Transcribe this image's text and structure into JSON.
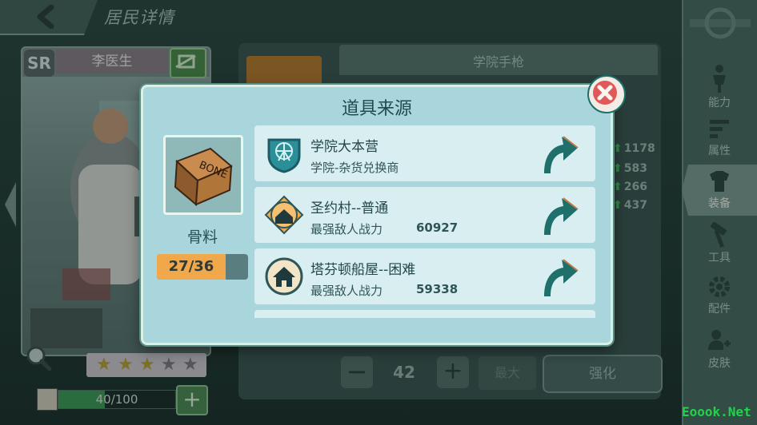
{
  "header": {
    "title": "居民详情"
  },
  "character": {
    "rarity": "SR",
    "name": "李医生",
    "stars_filled": 3,
    "stars_total": 5,
    "hp_text": "40/100",
    "hp_fraction": 0.4,
    "hp_add": "+"
  },
  "equipment": {
    "name": "学院手枪",
    "stats": [
      "1178",
      "583",
      "266",
      "437"
    ],
    "quantity": "42",
    "minus": "−",
    "plus": "+",
    "max_label": "最大",
    "enhance_label": "强化"
  },
  "sidebar": {
    "items": [
      {
        "label": "能力",
        "icon": "figure-icon"
      },
      {
        "label": "属性",
        "icon": "bars-icon"
      },
      {
        "label": "装备",
        "icon": "armor-icon"
      },
      {
        "label": "工具",
        "icon": "hammer-icon"
      },
      {
        "label": "配件",
        "icon": "gear-icon"
      },
      {
        "label": "皮肤",
        "icon": "person-add-icon"
      }
    ],
    "active": "装备"
  },
  "modal": {
    "title": "道具来源",
    "item": {
      "name": "骨料",
      "box_text": "BONE",
      "count_text": "27/36",
      "fraction": 0.75
    },
    "sources": [
      {
        "name": "学院大本营",
        "sub": "学院-杂货兑换商",
        "power": "",
        "icon": "institute-shield-icon"
      },
      {
        "name": "圣约村--普通",
        "sub": "最强敌人战力",
        "power": "60927",
        "icon": "orange-house-icon"
      },
      {
        "name": "塔芬顿船屋--困难",
        "sub": "最强敌人战力",
        "power": "59338",
        "icon": "blue-house-icon"
      }
    ]
  },
  "watermark": "Eoook.Net",
  "colors": {
    "accent_teal": "#1f6f6a",
    "progress_orange": "#f0a84b",
    "close_red": "#e0585a"
  }
}
